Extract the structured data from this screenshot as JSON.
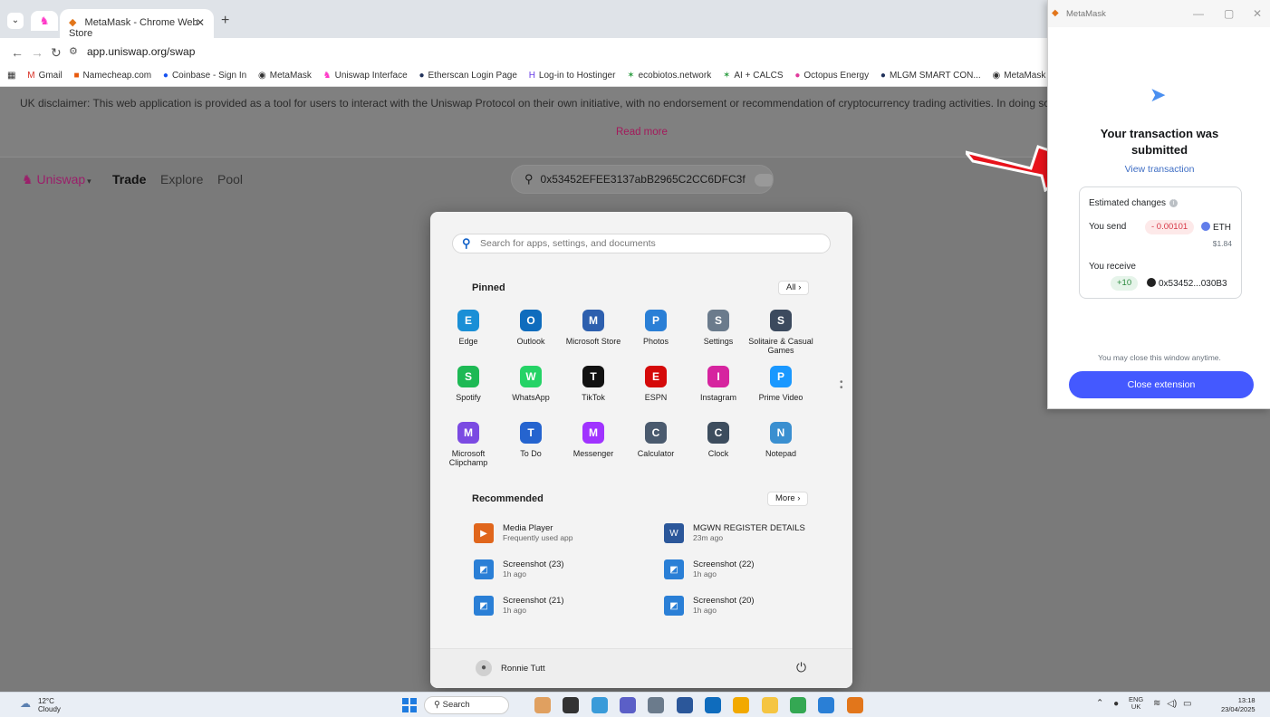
{
  "browser": {
    "tab_title": "MetaMask - Chrome Web Store",
    "url": "app.uniswap.org/swap",
    "bookmarks": [
      "Gmail",
      "Namecheap.com",
      "Coinbase - Sign In",
      "MetaMask",
      "Uniswap Interface",
      "Etherscan Login Page",
      "Log-in to Hostinger",
      "ecobiotos.network",
      "AI + CALCS",
      "Octopus Energy",
      "MLGM SMART CON...",
      "MetaMask"
    ]
  },
  "uniswap": {
    "disclaimer": "UK disclaimer: This web application is provided as a tool for users to interact with the Uniswap Protocol on their own initiative, with no endorsement or recommendation of cryptocurrency trading activities. In doing so, Unis",
    "read_more": "Read more",
    "logo": "Uniswap",
    "nav": {
      "trade": "Trade",
      "explore": "Explore",
      "pool": "Pool"
    },
    "search_value": "0x53452EFEE3137abB2965C2CC6DFC3f"
  },
  "start_menu": {
    "search_placeholder": "Search for apps, settings, and documents",
    "pinned_title": "Pinned",
    "all_label": "All",
    "pinned": [
      {
        "label": "Edge",
        "color": "#1a8fd6"
      },
      {
        "label": "Outlook",
        "color": "#0f6cbd"
      },
      {
        "label": "Microsoft Store",
        "color": "#2d5fae"
      },
      {
        "label": "Photos",
        "color": "#2a7fd6"
      },
      {
        "label": "Settings",
        "color": "#6b7b8c"
      },
      {
        "label": "Solitaire & Casual Games",
        "color": "#3c4a5e"
      },
      {
        "label": "Spotify",
        "color": "#1db954"
      },
      {
        "label": "WhatsApp",
        "color": "#25d366"
      },
      {
        "label": "TikTok",
        "color": "#111111"
      },
      {
        "label": "ESPN",
        "color": "#d50a0a"
      },
      {
        "label": "Instagram",
        "color": "#d6249f"
      },
      {
        "label": "Prime Video",
        "color": "#1a98ff"
      },
      {
        "label": "Microsoft Clipchamp",
        "color": "#7b4ae2"
      },
      {
        "label": "To Do",
        "color": "#2564cf"
      },
      {
        "label": "Messenger",
        "color": "#a033ff"
      },
      {
        "label": "Calculator",
        "color": "#4a5a6e"
      },
      {
        "label": "Clock",
        "color": "#3d4d5e"
      },
      {
        "label": "Notepad",
        "color": "#3a8fd0"
      }
    ],
    "recommended_title": "Recommended",
    "more_label": "More",
    "recommended": [
      {
        "name": "Media Player",
        "sub": "Frequently used app",
        "color": "#e0661c"
      },
      {
        "name": "MGWN REGISTER DETAILS",
        "sub": "23m ago",
        "color": "#2b579a"
      },
      {
        "name": "Screenshot (23)",
        "sub": "1h ago",
        "color": "#2a7fd6"
      },
      {
        "name": "Screenshot (22)",
        "sub": "1h ago",
        "color": "#2a7fd6"
      },
      {
        "name": "Screenshot (21)",
        "sub": "1h ago",
        "color": "#2a7fd6"
      },
      {
        "name": "Screenshot (20)",
        "sub": "1h ago",
        "color": "#2a7fd6"
      }
    ],
    "user_name": "Ronnie Tutt"
  },
  "metamask": {
    "window_title": "MetaMask",
    "heading": "Your transaction was submitted",
    "view_link": "View transaction",
    "estimated_changes": "Estimated changes",
    "you_send": "You send",
    "send_amount": "- 0.00101",
    "send_token": "ETH",
    "send_fiat": "$1.84",
    "you_receive": "You receive",
    "receive_amount": "+10",
    "receive_token": "0x53452...030B3",
    "close_note": "You may close this window anytime.",
    "close_button": "Close extension",
    "accent": "#4459ff"
  },
  "taskbar": {
    "temp": "12°C",
    "weather": "Cloudy",
    "search_label": "Search",
    "lang_top": "ENG",
    "lang_bottom": "UK",
    "time": "13:18",
    "date": "23/04/2025"
  }
}
